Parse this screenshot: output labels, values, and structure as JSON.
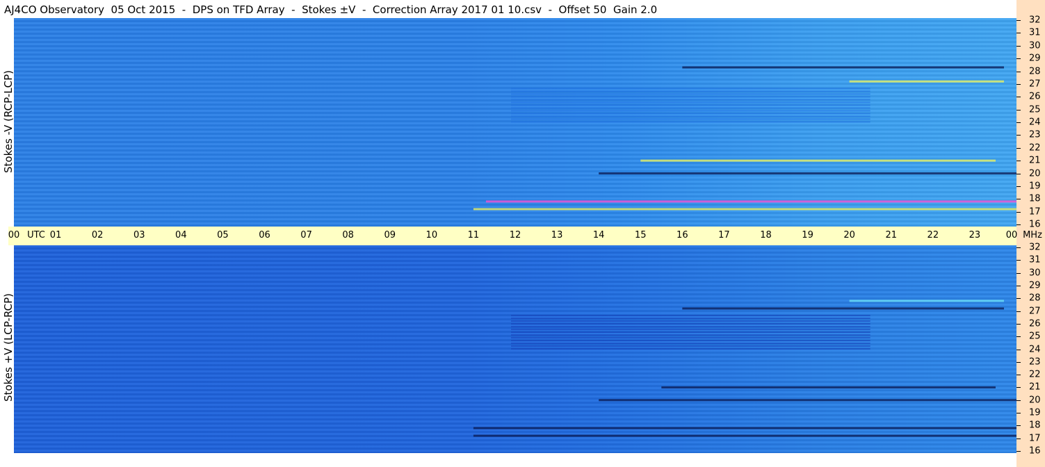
{
  "title": "AJ4CO Observatory  05 Oct 2015  -  DPS on TFD Array  -  Stokes ±V  -  Correction Array 2017 01 10.csv  -  Offset 50  Gain 2.0",
  "colors": {
    "top_panel_base": "#2b82e8",
    "bottom_panel_base": "#2066de",
    "time_bar": "#ffffc4",
    "freq_strip": "#ffe0c0",
    "hot_emission": "#ff4fd0",
    "yellow_emission": "#f2f55a",
    "dark_emission": "#0a1850",
    "cyan_emission": "#6fe3f5"
  },
  "chart_data": [
    {
      "type": "heatmap",
      "panel": "top",
      "ylabel": "Stokes -V (RCP-LCP)",
      "x_unit": "UTC",
      "y_unit": "MHz",
      "xlim": [
        0,
        24
      ],
      "ylim": [
        16,
        32
      ],
      "x_ticks": [
        "00",
        "01",
        "02",
        "03",
        "04",
        "05",
        "06",
        "07",
        "08",
        "09",
        "10",
        "11",
        "12",
        "13",
        "14",
        "15",
        "16",
        "17",
        "18",
        "19",
        "20",
        "21",
        "22",
        "23",
        "00"
      ],
      "y_ticks": [
        "16",
        "17",
        "18",
        "19",
        "20",
        "21",
        "22",
        "23",
        "24",
        "25",
        "26",
        "27",
        "28",
        "29",
        "30",
        "31",
        "32"
      ],
      "features": [
        {
          "kind": "band",
          "t0": 11.3,
          "t1": 24,
          "f": 17.8,
          "color": "hot_emission"
        },
        {
          "kind": "band",
          "t0": 11.0,
          "t1": 24,
          "f": 17.2,
          "color": "yellow_emission"
        },
        {
          "kind": "band",
          "t0": 14.0,
          "t1": 24,
          "f": 20.0,
          "color": "dark_emission"
        },
        {
          "kind": "band",
          "t0": 20.0,
          "t1": 23.7,
          "f": 27.2,
          "color": "yellow_emission"
        },
        {
          "kind": "band",
          "t0": 16.0,
          "t1": 23.7,
          "f": 28.3,
          "color": "dark_emission"
        },
        {
          "kind": "band",
          "t0": 15.0,
          "t1": 23.5,
          "f": 21.0,
          "color": "yellow_emission"
        },
        {
          "kind": "block",
          "t0": 11.9,
          "t1": 20.5,
          "f0": 24.0,
          "f1": 26.7,
          "color": "top_panel_base"
        }
      ]
    },
    {
      "type": "heatmap",
      "panel": "bottom",
      "ylabel": "Stokes +V (LCP-RCP)",
      "x_unit": "UTC",
      "y_unit": "MHz",
      "xlim": [
        0,
        24
      ],
      "ylim": [
        16,
        32
      ],
      "x_ticks": [
        "00",
        "01",
        "02",
        "03",
        "04",
        "05",
        "06",
        "07",
        "08",
        "09",
        "10",
        "11",
        "12",
        "13",
        "14",
        "15",
        "16",
        "17",
        "18",
        "19",
        "20",
        "21",
        "22",
        "23",
        "00"
      ],
      "y_ticks": [
        "16",
        "17",
        "18",
        "19",
        "20",
        "21",
        "22",
        "23",
        "24",
        "25",
        "26",
        "27",
        "28",
        "29",
        "30",
        "31",
        "32"
      ],
      "features": [
        {
          "kind": "band",
          "t0": 11.0,
          "t1": 24,
          "f": 17.8,
          "color": "dark_emission"
        },
        {
          "kind": "band",
          "t0": 11.0,
          "t1": 24,
          "f": 17.2,
          "color": "dark_emission"
        },
        {
          "kind": "band",
          "t0": 14.0,
          "t1": 24,
          "f": 20.0,
          "color": "dark_emission"
        },
        {
          "kind": "band",
          "t0": 16.0,
          "t1": 23.7,
          "f": 27.2,
          "color": "dark_emission"
        },
        {
          "kind": "band",
          "t0": 20.0,
          "t1": 23.7,
          "f": 27.8,
          "color": "cyan_emission"
        },
        {
          "kind": "band",
          "t0": 15.5,
          "t1": 23.5,
          "f": 21.0,
          "color": "dark_emission"
        },
        {
          "kind": "block",
          "t0": 11.9,
          "t1": 20.5,
          "f0": 24.0,
          "f1": 26.7,
          "color": "bottom_panel_base"
        }
      ]
    }
  ],
  "axis": {
    "utc_label": "UTC",
    "mhz_label": "MHz"
  }
}
